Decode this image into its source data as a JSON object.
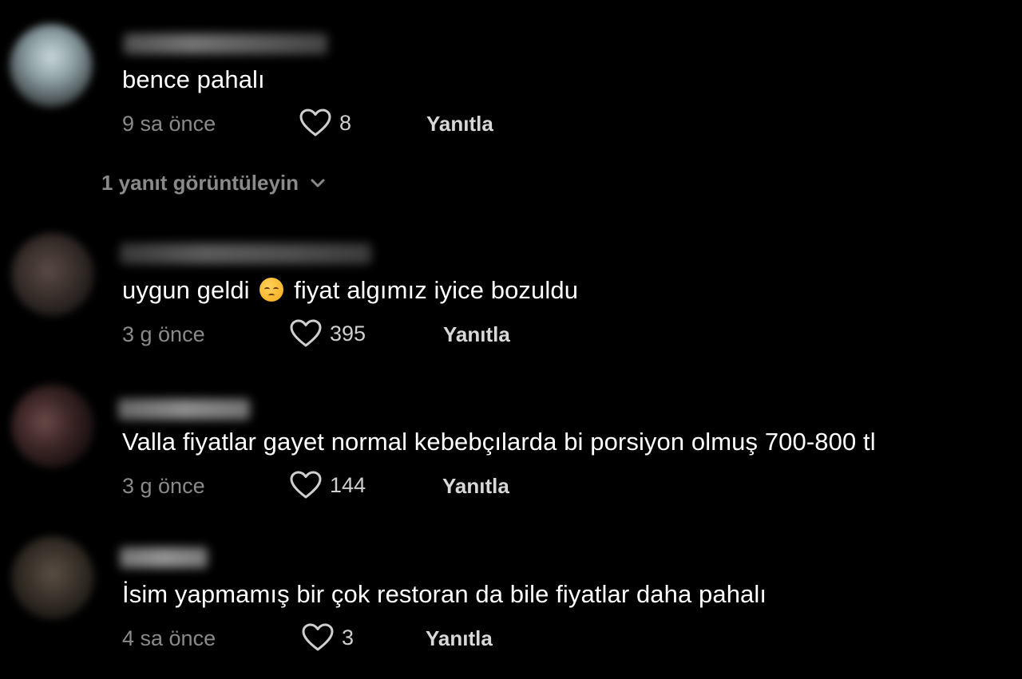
{
  "colors": {
    "background": "#000000",
    "text_primary": "#ffffff",
    "text_secondary": "#8a8a8a",
    "reply_text": "#d8d8d8"
  },
  "comments": [
    {
      "text": "bence pahalı",
      "time": "9 sa önce",
      "likes": "8",
      "reply_label": "Yanıtla",
      "avatar_icon": "blurred-avatar-icon",
      "like_icon": "heart-outline-icon"
    },
    {
      "text_before_emoji": "uygun geldi",
      "emoji": "pensive-face-emoji-icon",
      "text_after_emoji": "fiyat algımız iyice bozuldu",
      "time": "3 g önce",
      "likes": "395",
      "reply_label": "Yanıtla",
      "avatar_icon": "blurred-avatar-icon",
      "like_icon": "heart-outline-icon"
    },
    {
      "text": "Valla fiyatlar gayet normal kebebçılarda bi porsiyon olmuş 700-800 tl",
      "time": "3 g önce",
      "likes": "144",
      "reply_label": "Yanıtla",
      "avatar_icon": "blurred-avatar-icon",
      "like_icon": "heart-outline-icon"
    },
    {
      "text": "İsim yapmamış bir çok restoran da bile fiyatlar daha pahalı",
      "time": "4 sa önce",
      "likes": "3",
      "reply_label": "Yanıtla",
      "avatar_icon": "blurred-avatar-icon",
      "like_icon": "heart-outline-icon"
    }
  ],
  "view_replies": {
    "label": "1 yanıt görüntüleyin",
    "icon": "chevron-down-icon"
  }
}
